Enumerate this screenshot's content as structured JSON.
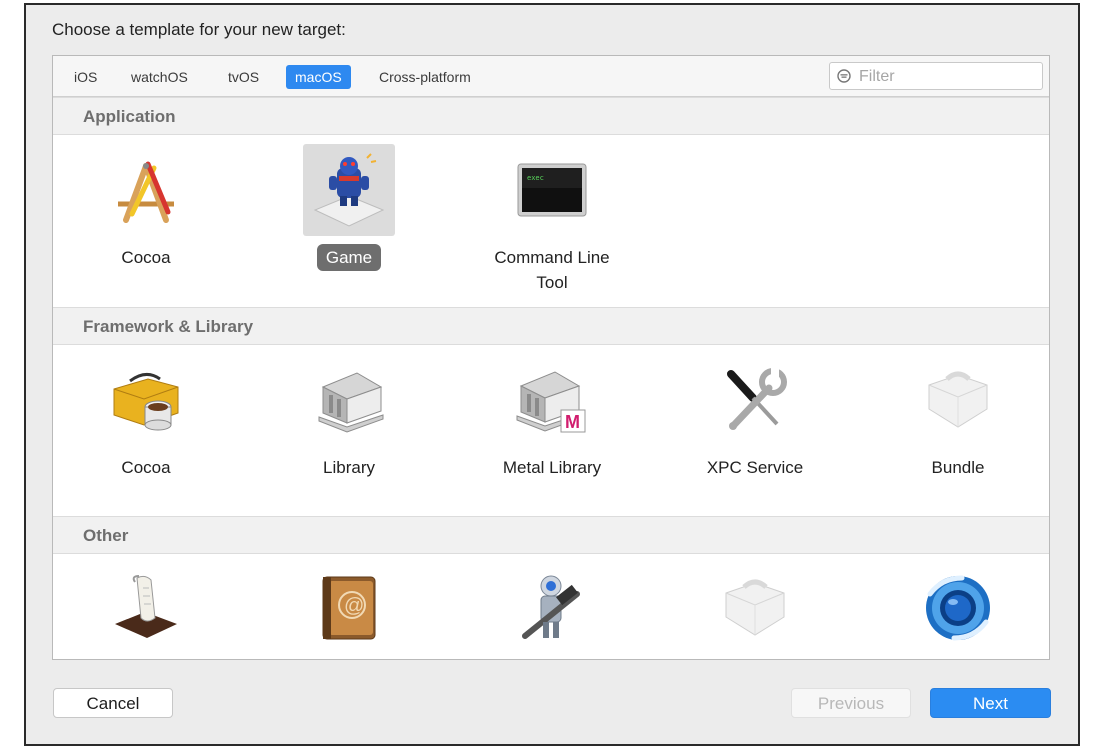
{
  "dialog": {
    "heading": "Choose a template for your new target:"
  },
  "tabs": [
    {
      "label": "iOS"
    },
    {
      "label": "watchOS"
    },
    {
      "label": "tvOS"
    },
    {
      "label": "macOS",
      "selected": true
    },
    {
      "label": "Cross-platform"
    }
  ],
  "filter": {
    "placeholder": "Filter",
    "value": ""
  },
  "sections": [
    {
      "title": "Application",
      "items": [
        {
          "label": "Cocoa",
          "icon": "cocoa-app-icon"
        },
        {
          "label": "Game",
          "icon": "game-icon",
          "selected": true
        },
        {
          "label": "Command Line\nTool",
          "icon": "terminal-icon",
          "icon_text": "exec"
        }
      ]
    },
    {
      "title": "Framework & Library",
      "items": [
        {
          "label": "Cocoa",
          "icon": "toolbox-icon"
        },
        {
          "label": "Library",
          "icon": "library-building-icon"
        },
        {
          "label": "Metal Library",
          "icon": "metal-library-icon",
          "badge_text": "M"
        },
        {
          "label": "XPC Service",
          "icon": "screwdriver-wrench-icon"
        },
        {
          "label": "Bundle",
          "icon": "bundle-icon"
        }
      ]
    },
    {
      "title": "Other",
      "items": [
        {
          "label": "",
          "icon": "scroll-script-icon"
        },
        {
          "label": "",
          "icon": "address-book-icon",
          "icon_text": "@"
        },
        {
          "label": "",
          "icon": "automator-robot-icon"
        },
        {
          "label": "",
          "icon": "bundle-icon"
        },
        {
          "label": "",
          "icon": "instruments-icon"
        }
      ]
    }
  ],
  "buttons": {
    "cancel": "Cancel",
    "previous": "Previous",
    "next": "Next"
  },
  "colors": {
    "accent": "#2e89f0",
    "selected_label_bg": "#6e6e6e",
    "section_header_text": "#6e6e6e"
  }
}
